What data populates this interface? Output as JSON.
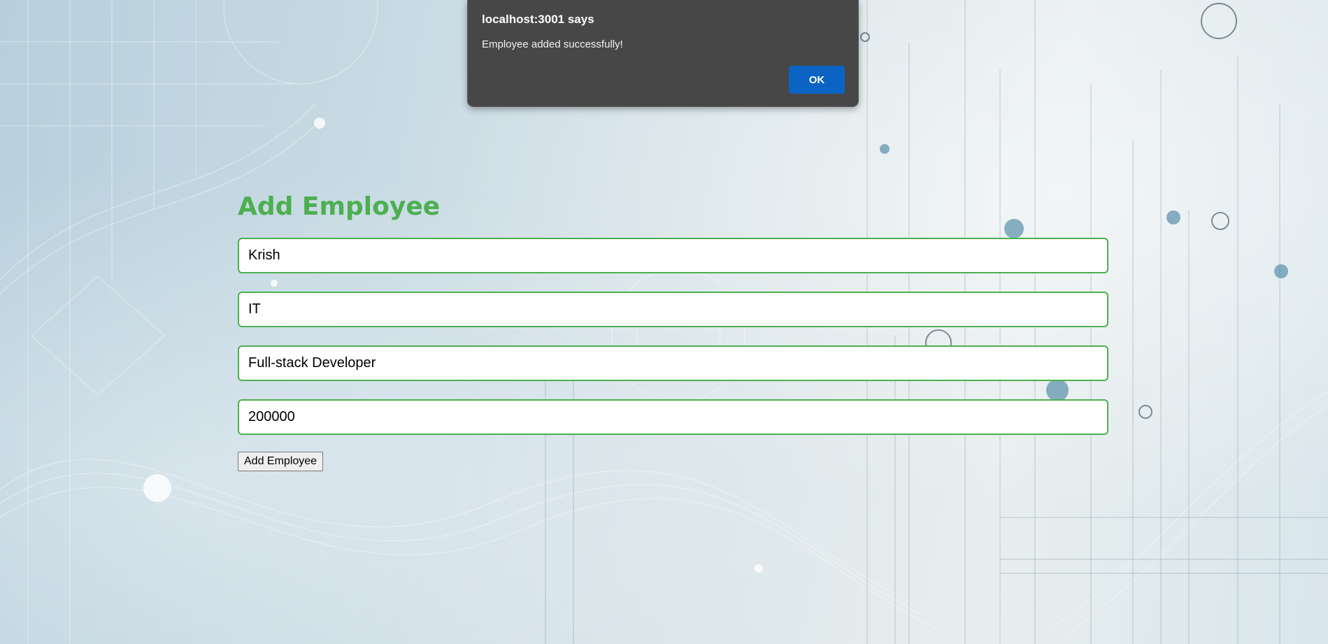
{
  "form": {
    "title": "Add Employee",
    "fields": [
      {
        "name": "employee-name-input",
        "value": "Krish"
      },
      {
        "name": "department-input",
        "value": "IT"
      },
      {
        "name": "position-input",
        "value": "Full-stack Developer"
      },
      {
        "name": "salary-input",
        "value": "200000"
      }
    ],
    "submit_label": "Add Employee"
  },
  "alert": {
    "origin": "localhost:3001 says",
    "message": "Employee added successfully!",
    "ok_label": "OK"
  },
  "colors": {
    "title_green": "#4caf50",
    "field_border": "#4caf50",
    "dialog_bg": "#474747",
    "ok_button": "#0b63c4"
  }
}
